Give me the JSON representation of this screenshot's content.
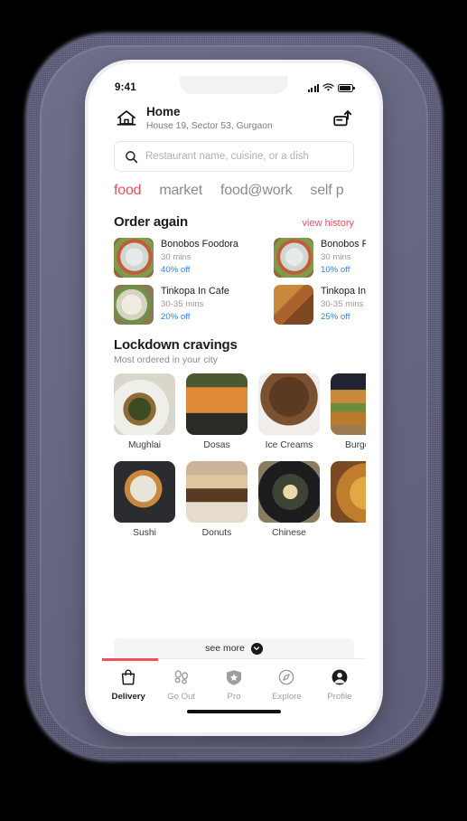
{
  "status_bar": {
    "time": "9:41",
    "signal_icon": "cellular-bars-icon",
    "wifi_icon": "wifi-icon",
    "battery_icon": "battery-icon"
  },
  "header": {
    "home_icon": "home-icon",
    "title": "Home",
    "address": "House 19, Sector 53, Gurgaon",
    "share_icon": "share-icon"
  },
  "search": {
    "icon": "search-icon",
    "value": "",
    "placeholder": "Restaurant name, cuisine, or a dish"
  },
  "tabs": [
    {
      "label": "food",
      "active": true
    },
    {
      "label": "market",
      "active": false
    },
    {
      "label": "food@work",
      "active": false
    },
    {
      "label": "self p",
      "active": false
    }
  ],
  "order_again": {
    "title": "Order again",
    "link": "view history",
    "items": [
      {
        "name": "Bonobos Foodora",
        "time": "30 mins",
        "offer": "40% off"
      },
      {
        "name": "Bonobos Foodo",
        "time": "30 mins",
        "offer": "10% off"
      },
      {
        "name": "Tinkopa In Cafe",
        "time": "30-35 mins",
        "offer": "20% off"
      },
      {
        "name": "Tinkopa In Cafe",
        "time": "30-35 mins",
        "offer": "25% off"
      }
    ]
  },
  "cravings": {
    "title": "Lockdown cravings",
    "subtitle": "Most ordered in your city",
    "items": [
      {
        "label": "Mughlai"
      },
      {
        "label": "Dosas"
      },
      {
        "label": "Ice Creams"
      },
      {
        "label": "Burgers"
      },
      {
        "label": "Sushi"
      },
      {
        "label": "Donuts"
      },
      {
        "label": "Chinese"
      },
      {
        "label": ""
      }
    ]
  },
  "see_more": {
    "label": "see more",
    "icon": "chevron-down-icon"
  },
  "bottom_nav": [
    {
      "label": "Delivery",
      "icon": "shopping-bag-icon",
      "active": true
    },
    {
      "label": "Go Out",
      "icon": "footsteps-icon",
      "active": false
    },
    {
      "label": "Pro",
      "icon": "shield-star-icon",
      "active": false
    },
    {
      "label": "Explore",
      "icon": "compass-icon",
      "active": false
    },
    {
      "label": "Profile",
      "icon": "avatar-icon",
      "active": false
    }
  ],
  "colors": {
    "accent_red": "#ef4f5f",
    "offer_blue": "#2d7ff9",
    "text_dark": "#1c1c1c",
    "text_muted": "#9a9a9a"
  }
}
